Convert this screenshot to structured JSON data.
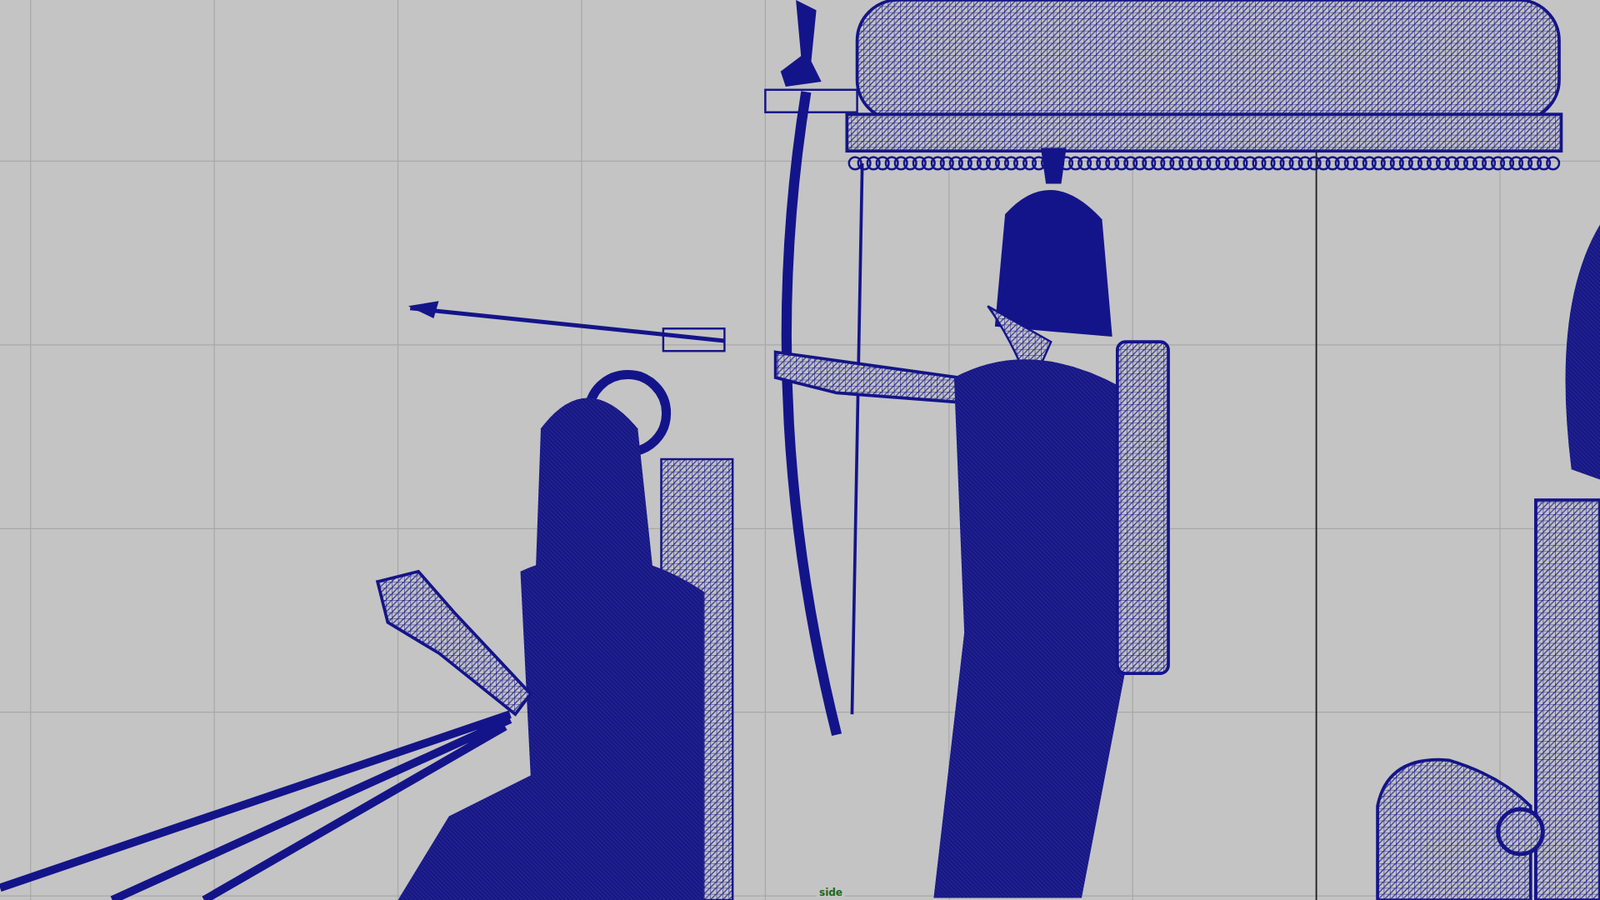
{
  "viewport": {
    "label": "side"
  }
}
